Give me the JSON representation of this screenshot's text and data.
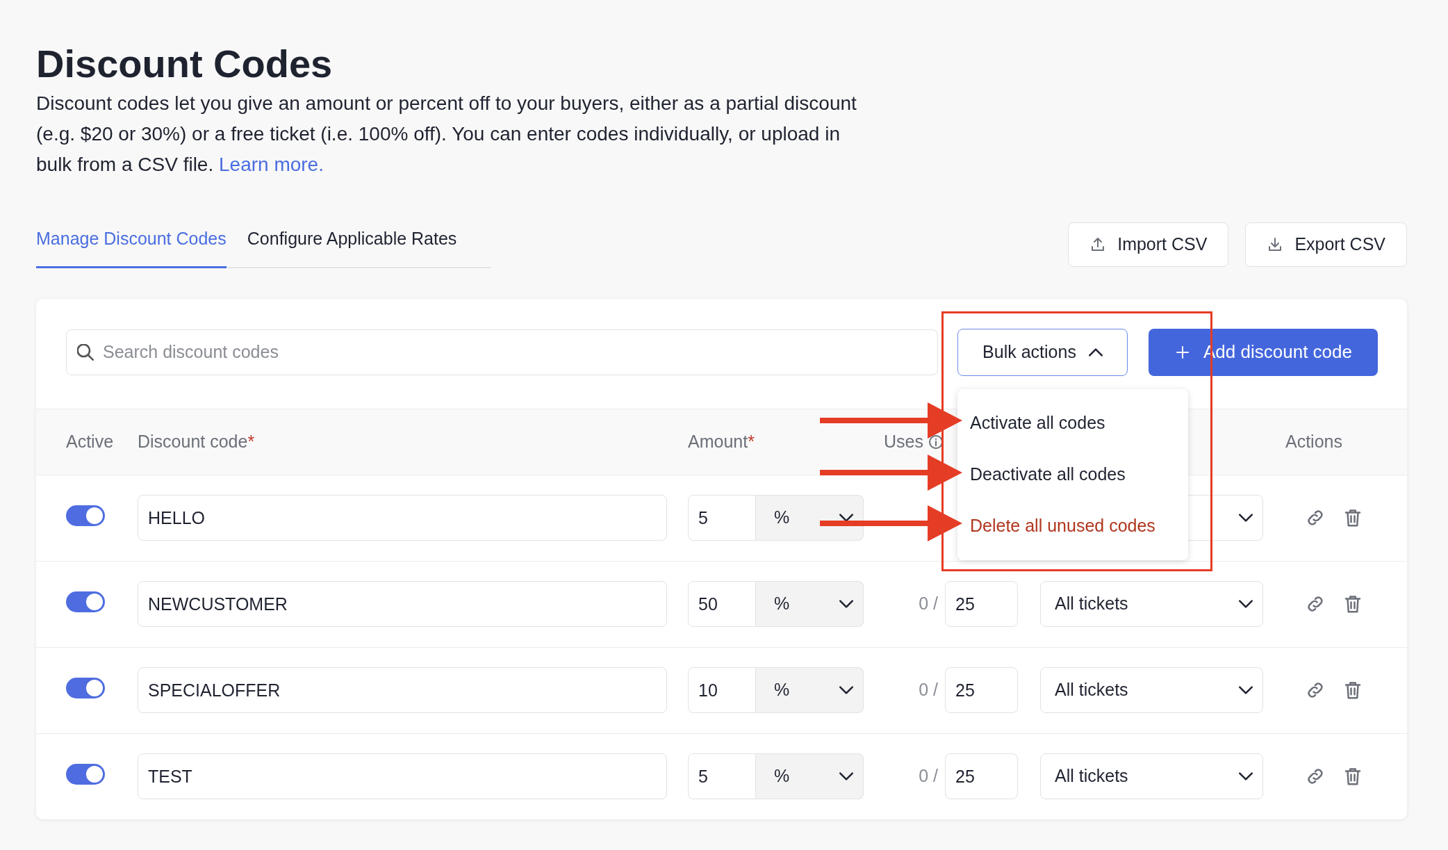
{
  "title": "Discount Codes",
  "description": "Discount codes let you give an amount or percent off to your buyers, either as a partial discount (e.g. $20 or 30%) or a free ticket (i.e. 100% off). You can enter codes individually, or upload in bulk from a CSV file.",
  "learn_more": "Learn more.",
  "tabs": [
    {
      "label": "Manage Discount Codes",
      "selected": true
    },
    {
      "label": "Configure Applicable Rates",
      "selected": false
    }
  ],
  "toolbar_buttons": [
    {
      "label": "Import CSV",
      "kind": "import"
    },
    {
      "label": "Export CSV",
      "kind": "export"
    }
  ],
  "search": {
    "placeholder": "Search discount codes"
  },
  "bulk_actions": {
    "label": "Bulk actions",
    "expanded": true,
    "items": [
      {
        "label": "Activate all codes",
        "kind": "normal"
      },
      {
        "label": "Deactivate all codes",
        "kind": "normal"
      },
      {
        "label": "Delete all unused codes",
        "kind": "danger"
      }
    ]
  },
  "add_button": "Add discount code",
  "columns": [
    {
      "label": "Active"
    },
    {
      "label": "Discount code",
      "marker": "*"
    },
    {
      "label": "Amount",
      "marker": "*"
    },
    {
      "label": "Uses",
      "info": true
    },
    {
      "label": "Actions"
    }
  ],
  "rows": [
    {
      "active": true,
      "code": "HELLO",
      "amount": "5",
      "unit": "%"
    },
    {
      "active": true,
      "code": "NEWCUSTOMER",
      "amount": "50",
      "unit": "%",
      "used": "0 /",
      "limit": "25",
      "tickets": "All tickets"
    },
    {
      "active": true,
      "code": "SPECIALOFFER",
      "amount": "10",
      "unit": "%",
      "used": "0 /",
      "limit": "25",
      "tickets": "All tickets"
    },
    {
      "active": true,
      "code": "TEST",
      "amount": "5",
      "unit": "%",
      "used": "0 /",
      "limit": "25",
      "tickets": "All tickets"
    }
  ]
}
